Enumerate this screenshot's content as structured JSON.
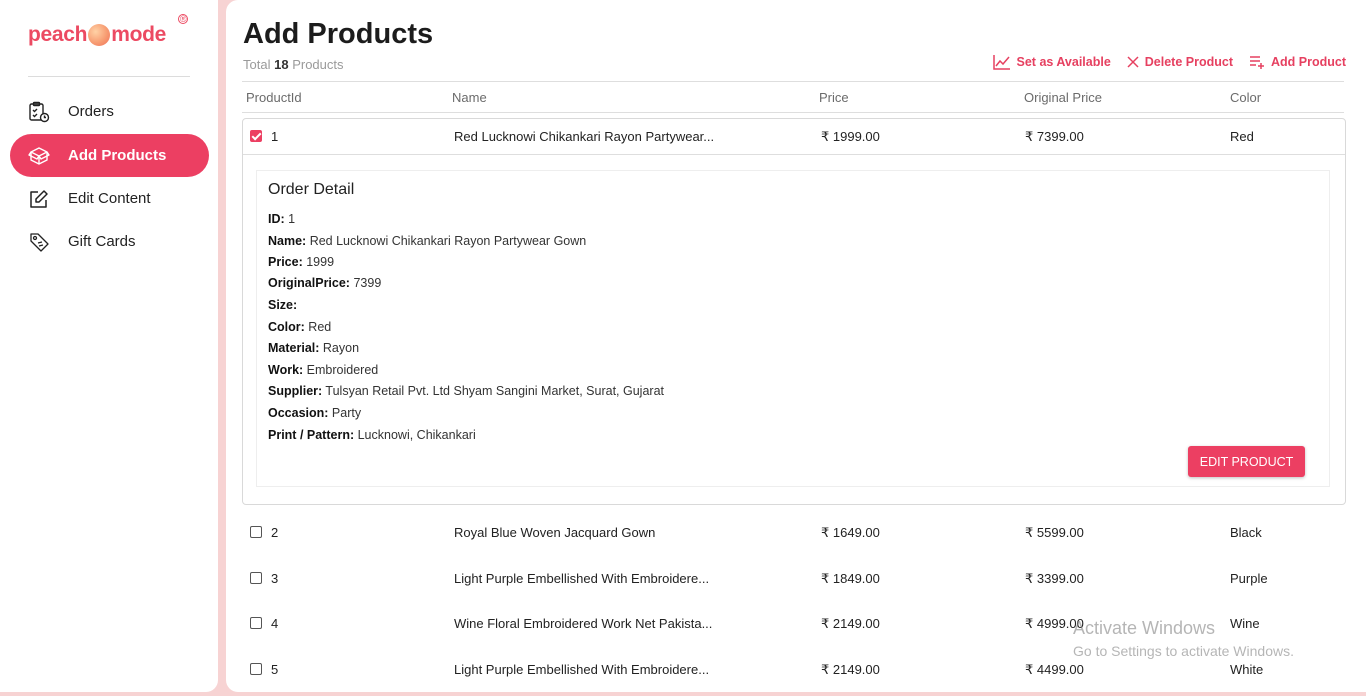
{
  "brand": {
    "logo_left": "peach",
    "logo_right": "mode",
    "registered": "®"
  },
  "sidebar": {
    "items": [
      {
        "label": "Orders",
        "icon": "orders-clipboard-icon"
      },
      {
        "label": "Add Products",
        "icon": "box-icon",
        "active": true
      },
      {
        "label": "Edit Content",
        "icon": "edit-icon"
      },
      {
        "label": "Gift Cards",
        "icon": "tag-icon"
      }
    ]
  },
  "header": {
    "title": "Add Products",
    "total_prefix": "Total",
    "total_count": "18",
    "total_suffix": "Products",
    "actions": {
      "available": "Set as Available",
      "delete": "Delete Product",
      "add": "Add Product"
    }
  },
  "table": {
    "columns": [
      "ProductId",
      "Name",
      "Price",
      "Original Price",
      "Color"
    ],
    "rows": [
      {
        "id": "1",
        "name": "Red Lucknowi Chikankari Rayon Partywear...",
        "price": "₹ 1999.00",
        "original_price": "₹ 7399.00",
        "color": "Red",
        "checked": true
      },
      {
        "id": "2",
        "name": "Royal Blue Woven Jacquard Gown",
        "price": "₹ 1649.00",
        "original_price": "₹ 5599.00",
        "color": "Black",
        "checked": false
      },
      {
        "id": "3",
        "name": "Light Purple Embellished With Embroidere...",
        "price": "₹ 1849.00",
        "original_price": "₹ 3399.00",
        "color": "Purple",
        "checked": false
      },
      {
        "id": "4",
        "name": "Wine Floral Embroidered Work Net Pakista...",
        "price": "₹ 2149.00",
        "original_price": "₹ 4999.00",
        "color": "Wine",
        "checked": false
      },
      {
        "id": "5",
        "name": "Light Purple Embellished With Embroidere...",
        "price": "₹ 2149.00",
        "original_price": "₹ 4499.00",
        "color": "White",
        "checked": false
      }
    ]
  },
  "detail": {
    "title": "Order Detail",
    "fields": [
      {
        "label": "ID:",
        "value": "1"
      },
      {
        "label": "Name:",
        "value": "Red Lucknowi Chikankari Rayon Partywear Gown"
      },
      {
        "label": "Price:",
        "value": "1999"
      },
      {
        "label": "OriginalPrice:",
        "value": "7399"
      },
      {
        "label": "Size:",
        "value": ""
      },
      {
        "label": "Color:",
        "value": "Red"
      },
      {
        "label": "Material:",
        "value": "Rayon"
      },
      {
        "label": "Work:",
        "value": "Embroidered"
      },
      {
        "label": "Supplier:",
        "value": "Tulsyan Retail Pvt. Ltd Shyam Sangini Market, Surat, Gujarat"
      },
      {
        "label": "Occasion:",
        "value": "Party"
      },
      {
        "label": "Print / Pattern:",
        "value": "Lucknowi, Chikankari"
      }
    ],
    "edit_button": "EDIT PRODUCT"
  },
  "watermark": {
    "line1": "Activate Windows",
    "line2": "Go to Settings to activate Windows."
  },
  "colors": {
    "accent": "#ec3f62",
    "background": "#f7d3d3"
  }
}
